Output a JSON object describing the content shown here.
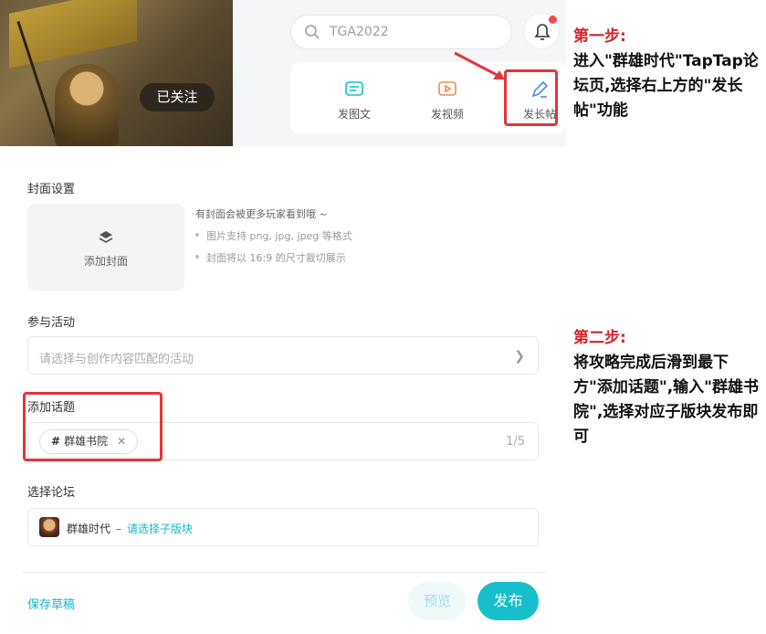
{
  "header": {
    "follow_label": "已关注",
    "search_text": "TGA2022",
    "post_actions": [
      {
        "label": "发图文",
        "icon": "image-post-icon"
      },
      {
        "label": "发视频",
        "icon": "video-post-icon"
      },
      {
        "label": "发长帖",
        "icon": "pen-icon"
      }
    ]
  },
  "notes": {
    "step1_title": "第一步:",
    "step1_text": "进入\"群雄时代\"TapTap论坛页,选择右上方的\"发长帖\"功能",
    "step2_title": "第二步:",
    "step2_text": "将攻略完成后滑到最下方\"添加话题\",输入\"群雄书院\",选择对应子版块发布即可"
  },
  "form": {
    "cover_label": "封面设置",
    "cover_add": "添加封面",
    "cover_hint": "有封面会被更多玩家看到哦 ~",
    "cover_tips": [
      "图片支持 png, jpg, jpeg 等格式",
      "封面将以 16:9 的尺寸裁切展示"
    ],
    "activity_label": "参与活动",
    "activity_placeholder": "请选择与创作内容匹配的活动",
    "topic_label": "添加话题",
    "topic_tag": "群雄书院",
    "topic_count": "1/5",
    "forum_label": "选择论坛",
    "forum_name": "群雄时代",
    "forum_sep": "–",
    "forum_pick": "请选择子版块",
    "save_draft": "保存草稿",
    "preview": "预览",
    "publish": "发布"
  },
  "colors": {
    "accent": "#16bfc9",
    "annotation_red": "#e0363b",
    "step_red": "#d4222a"
  }
}
